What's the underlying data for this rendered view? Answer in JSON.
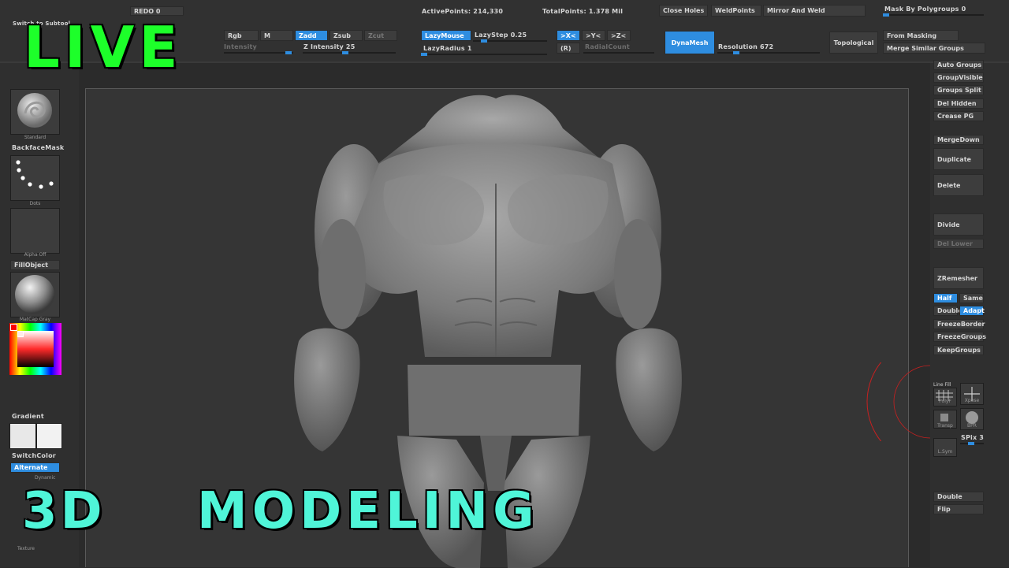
{
  "topbar": {
    "redo": "REDO 0",
    "switch_to_subtool": "Switch to Subtool",
    "active_points": "ActivePoints: 214,330",
    "total_points": "TotalPoints: 1.378 Mil",
    "close_holes": "Close Holes",
    "weld_points": "WeldPoints",
    "mirror_and_weld": "Mirror And Weld",
    "mask_by_polygroups": "Mask By Polygroups 0",
    "rgb": "Rgb",
    "m": "M",
    "zadd": "Zadd",
    "zsub": "Zsub",
    "zcut": "Zcut",
    "rgb_intensity": "Intensity",
    "z_intensity": "Z Intensity 25",
    "lazy_mouse": "LazyMouse",
    "lazy_step": "LazyStep 0.25",
    "lazy_radius": "LazyRadius 1",
    "sym_x": ">X<",
    "sym_y": ">Y<",
    "sym_z": ">Z<",
    "sym_r": "(R)",
    "radial_count": "RadialCount",
    "dynamesh": "DynaMesh",
    "resolution": "Resolution 672",
    "topological": "Topological",
    "from_masking": "From Masking",
    "merge_similar": "Merge Similar Groups"
  },
  "left": {
    "brush_caption": "Standard",
    "backface_mask": "BackfaceMask",
    "stroke_caption": "Dots",
    "alpha_caption": "Alpha  Off",
    "fill_object": "FillObject",
    "material_caption": "MatCap  Gray",
    "gradient": "Gradient",
    "switch_color": "SwitchColor",
    "alternate": "Alternate",
    "dynamic": "Dynamic",
    "texture": "Texture"
  },
  "right": {
    "auto_groups": "Auto Groups",
    "group_visible": "GroupVisible",
    "groups_split": "Groups Split",
    "del_hidden": "Del Hidden",
    "crease_pg": "Crease PG",
    "merge_down": "MergeDown",
    "duplicate": "Duplicate",
    "delete": "Delete",
    "divide": "Divide",
    "del_lower": "Del Lower",
    "zremesher": "ZRemesher",
    "half": "Half",
    "same": "Same",
    "double": "Double",
    "adapt": "Adapt",
    "freeze_border": "FreezeBorder",
    "freeze_groups": "FreezeGroups",
    "keep_groups": "KeepGroups",
    "line_fill": "Line Fill",
    "polyf": "PolyF",
    "xpose": "Xpose",
    "transp": "Transp",
    "bpr": "BPR",
    "spix": "SPix 3",
    "lsym": "L.Sym",
    "double2": "Double",
    "flip": "Flip"
  },
  "overlay": {
    "live": "LIVE",
    "three_d": "3D",
    "modeling": "MODELING"
  },
  "colors": {
    "accent": "#2e8de0",
    "live_green": "#1dff2a",
    "modeling_cyan": "#4ff5d8",
    "brush_cursor": "#c82020"
  }
}
